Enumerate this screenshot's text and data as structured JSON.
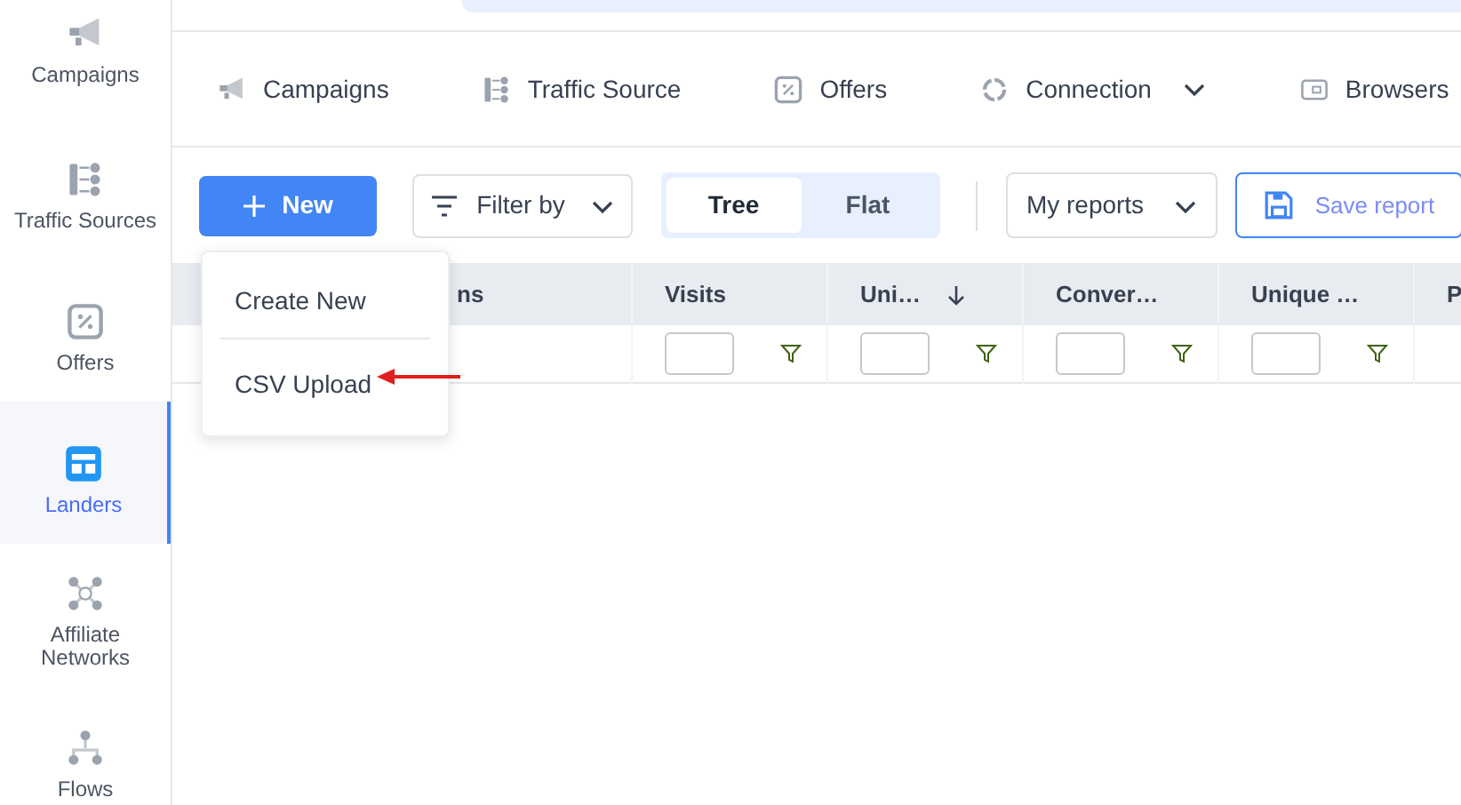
{
  "sidebar": {
    "items": [
      {
        "label": "Campaigns",
        "selected": false
      },
      {
        "label": "Traffic Sources",
        "selected": false
      },
      {
        "label": "Offers",
        "selected": false
      },
      {
        "label": "Landers",
        "selected": true
      },
      {
        "label": "Affiliate Networks",
        "selected": false
      },
      {
        "label": "Flows",
        "selected": false
      }
    ]
  },
  "tabs": [
    {
      "label": "Campaigns",
      "dropdown": false
    },
    {
      "label": "Traffic Source",
      "dropdown": false
    },
    {
      "label": "Offers",
      "dropdown": false
    },
    {
      "label": "Connection",
      "dropdown": true
    },
    {
      "label": "Browsers",
      "dropdown": false
    }
  ],
  "toolbar": {
    "new_button": "New",
    "filter": "Filter by",
    "view_toggle": [
      {
        "label": "Tree",
        "selected": true
      },
      {
        "label": "Flat",
        "selected": false
      }
    ],
    "reports": "My reports",
    "save": "Save report"
  },
  "menu": {
    "items": [
      "Create New",
      "CSV Upload"
    ]
  },
  "table": {
    "columns": [
      {
        "label": "ns"
      },
      {
        "label": "Visits",
        "sorted": false,
        "filter": true
      },
      {
        "label": "Uni…",
        "sorted": true,
        "filter": true
      },
      {
        "label": "Conver…",
        "sorted": false,
        "filter": true
      },
      {
        "label": "Unique …",
        "sorted": false,
        "filter": true
      },
      {
        "label": "P"
      }
    ]
  }
}
